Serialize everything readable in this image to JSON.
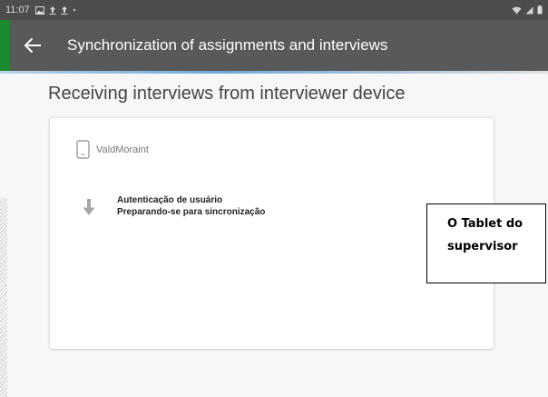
{
  "status_bar": {
    "time": "11:07",
    "left_icons": [
      "image-icon",
      "upload-icon",
      "upload-icon",
      "dot-icon"
    ],
    "right_icons": [
      "wifi-icon",
      "signal-icon",
      "battery-icon"
    ]
  },
  "toolbar": {
    "back_icon": "arrow-left-icon",
    "title": "Synchronization of assignments and interviews"
  },
  "main": {
    "heading": "Receiving interviews from interviewer device"
  },
  "card": {
    "device_icon": "tablet-icon",
    "device_name": "ValdMoraint",
    "step_icon": "arrow-down-icon",
    "steps": [
      "Autenticação de usuário",
      "Preparando-se para sincronização"
    ]
  },
  "annotation": {
    "lines": [
      "O Tablet do",
      "supervisor"
    ]
  },
  "colors": {
    "status_bar": "#4d4d4d",
    "toolbar": "#595959",
    "accent_green": "#1c8a2e",
    "background": "#f7f7f7",
    "card": "#ffffff"
  }
}
